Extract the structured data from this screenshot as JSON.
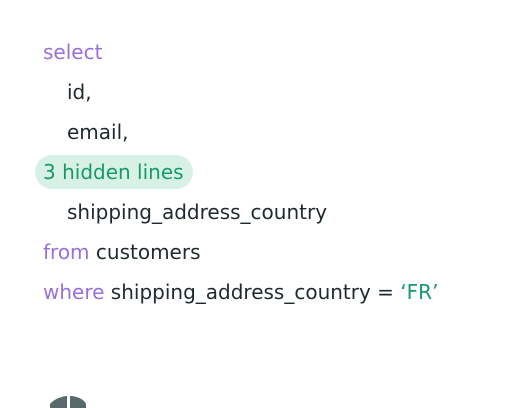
{
  "code": {
    "select_kw": "select",
    "col_id": "id,",
    "col_email": "email,",
    "hidden_lines_label": "3 hidden lines",
    "col_country": "shipping_address_country",
    "from_kw": "from",
    "from_table": "customers",
    "where_kw": "where",
    "where_condition": "shipping_address_country = ",
    "where_value": "‘FR’"
  },
  "colors": {
    "keyword": "#9b6fd8",
    "string": "#179a6b",
    "text": "#1f2a2e",
    "pill_bg": "#d8f1e7"
  },
  "icons": {
    "footer_logo": "partial-logo-icon"
  }
}
